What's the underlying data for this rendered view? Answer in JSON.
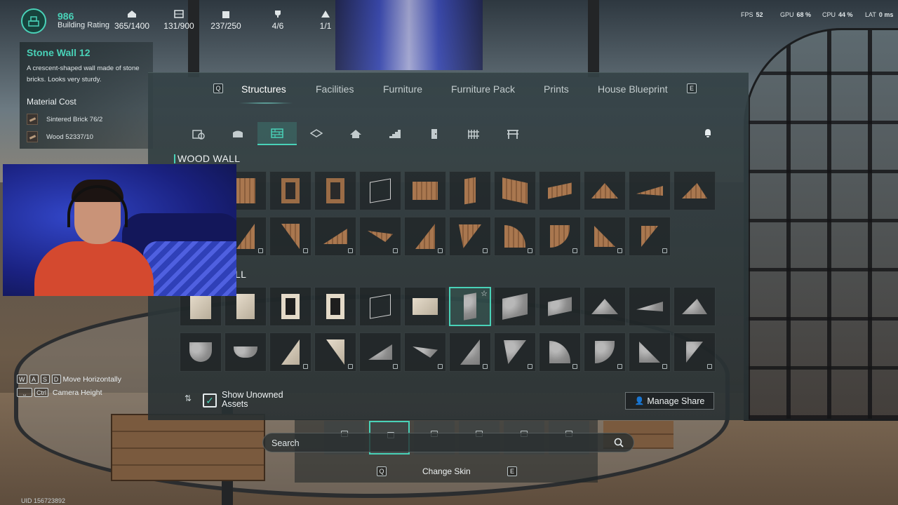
{
  "hud": {
    "rating_value": "986",
    "rating_label": "Building Rating",
    "stats": [
      "365/1400",
      "131/900",
      "237/250",
      "4/6",
      "1/1"
    ],
    "fps_label": "FPS",
    "fps_value": "52",
    "gpu_label": "GPU",
    "gpu_value": "68 %",
    "cpu_label": "CPU",
    "cpu_value": "44 %",
    "lat_label": "LAT",
    "lat_value": "0 ms"
  },
  "info": {
    "title": "Stone Wall 12",
    "description": "A crescent-shaped wall made of stone bricks. Looks very sturdy.",
    "material_cost_label": "Material Cost",
    "materials": [
      {
        "name": "Sintered Brick",
        "amount": "76/2"
      },
      {
        "name": "Wood",
        "amount": "52337/10"
      }
    ]
  },
  "controls": {
    "keys_move": [
      "W",
      "A",
      "S",
      "D"
    ],
    "move_label": "Move Horizontally",
    "key_ctrl": "Ctrl",
    "camera_label": "Camera Height",
    "uid": "UID  156723892"
  },
  "panel": {
    "prev_key": "Q",
    "next_key": "E",
    "tabs": [
      "Structures",
      "Facilities",
      "Furniture",
      "Furniture Pack",
      "Prints",
      "House Blueprint"
    ],
    "active_tab": "Structures",
    "section1": "WOOD WALL",
    "section2": "LL",
    "show_unowned_label": "Show Unowned Assets",
    "show_unowned_checked": true,
    "manage_share_label": "Manage Share"
  },
  "skin_bar": {
    "search_placeholder": "Search",
    "prev_key": "Q",
    "next_key": "E",
    "change_skin_label": "Change Skin"
  },
  "colors": {
    "accent": "#49d2b8",
    "panel_bg": "#34424a"
  }
}
